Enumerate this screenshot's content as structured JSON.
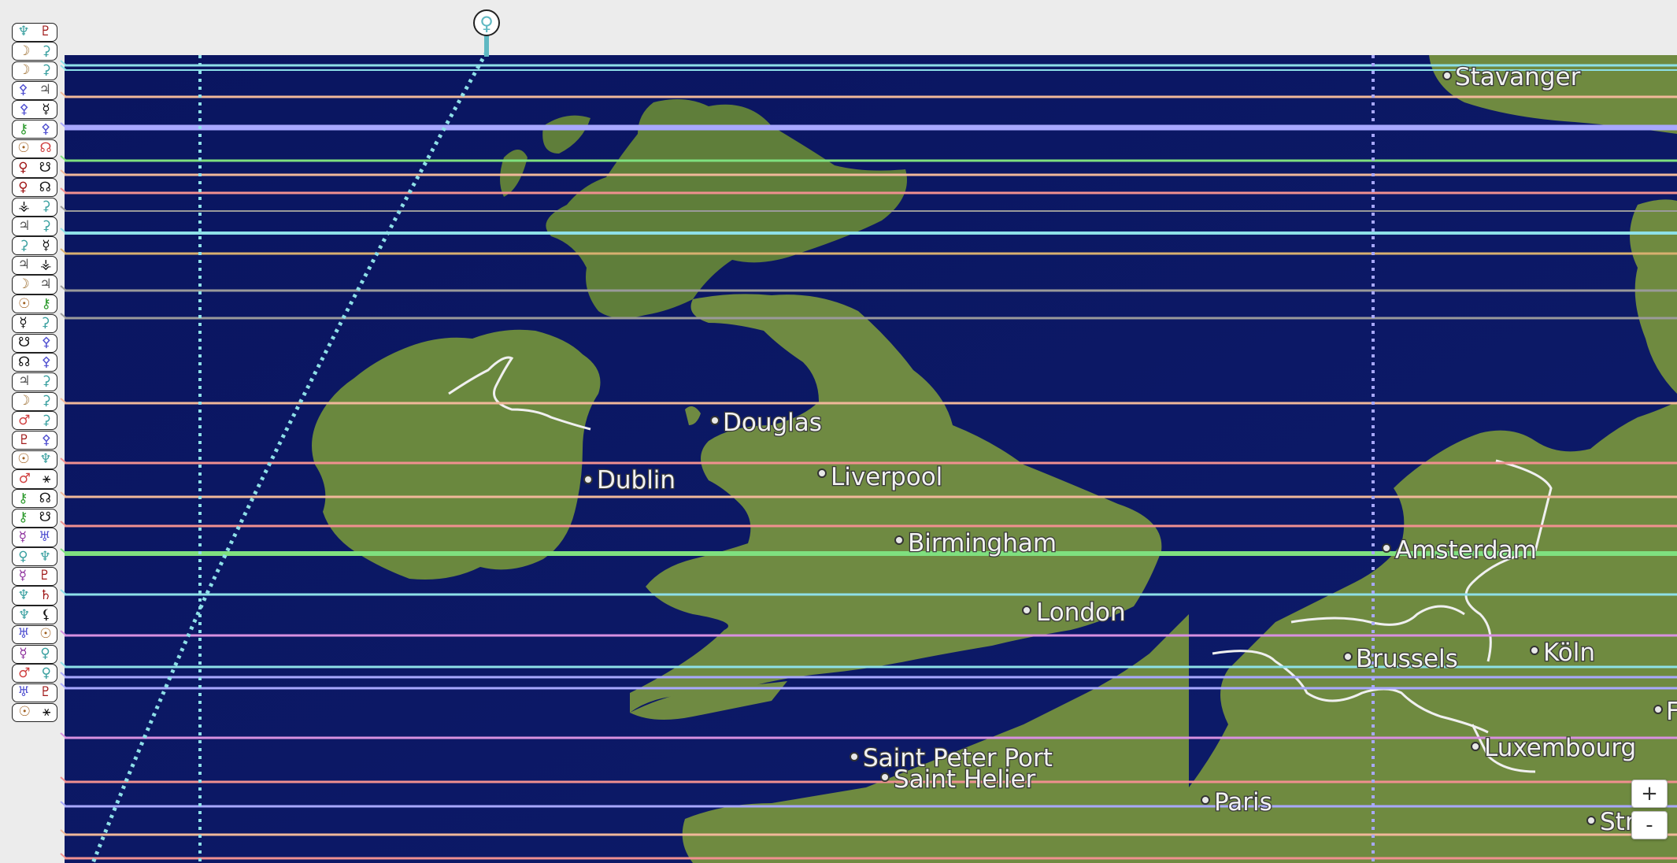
{
  "planet_marker": {
    "glyph": "♀",
    "color": "#5fb8c2"
  },
  "cities": [
    {
      "name": "Stavanger"
    },
    {
      "name": "Douglas"
    },
    {
      "name": "Dublin"
    },
    {
      "name": "Liverpool"
    },
    {
      "name": "Birmingham"
    },
    {
      "name": "Amsterdam"
    },
    {
      "name": "London"
    },
    {
      "name": "Brussels"
    },
    {
      "name": "Köln"
    },
    {
      "name": "Luxembourg"
    },
    {
      "name": "Saint Peter Port"
    },
    {
      "name": "Saint Helier"
    },
    {
      "name": "Paris"
    },
    {
      "name": "Str"
    },
    {
      "name": "F"
    }
  ],
  "zoom": {
    "in_label": "+",
    "out_label": "-"
  },
  "aspect_pairs": [
    {
      "a": "♆",
      "ac": "#3aa0a0",
      "b": "♇",
      "bc": "#a01818"
    },
    {
      "a": "☽",
      "ac": "#9a6a2a",
      "b": "⚳",
      "bc": "#3aa0a0"
    },
    {
      "a": "☽",
      "ac": "#9a6a2a",
      "b": "⚳",
      "bc": "#3aa0a0"
    },
    {
      "a": "⚴",
      "ac": "#5050d0",
      "b": "♃",
      "bc": "#555"
    },
    {
      "a": "⚴",
      "ac": "#5050d0",
      "b": "☿",
      "bc": "#111"
    },
    {
      "a": "⚷",
      "ac": "#2c9a2c",
      "b": "⚴",
      "bc": "#5050d0"
    },
    {
      "a": "☉",
      "ac": "#a06020",
      "b": "☊",
      "bc": "#d04040"
    },
    {
      "a": "♀",
      "ac": "#a01818",
      "b": "☋",
      "bc": "#111"
    },
    {
      "a": "♀",
      "ac": "#a01818",
      "b": "☊",
      "bc": "#111"
    },
    {
      "a": "⚶",
      "ac": "#111",
      "b": "⚳",
      "bc": "#3aa0a0"
    },
    {
      "a": "♃",
      "ac": "#555",
      "b": "⚳",
      "bc": "#3aa0a0"
    },
    {
      "a": "⚳",
      "ac": "#3aa0a0",
      "b": "☿",
      "bc": "#111"
    },
    {
      "a": "♃",
      "ac": "#555",
      "b": "⚶",
      "bc": "#111"
    },
    {
      "a": "☽",
      "ac": "#9a6a2a",
      "b": "♃",
      "bc": "#555"
    },
    {
      "a": "☉",
      "ac": "#a06020",
      "b": "⚷",
      "bc": "#2c9a2c"
    },
    {
      "a": "☿",
      "ac": "#111",
      "b": "⚳",
      "bc": "#3aa0a0"
    },
    {
      "a": "☋",
      "ac": "#111",
      "b": "⚴",
      "bc": "#5050d0"
    },
    {
      "a": "☊",
      "ac": "#111",
      "b": "⚴",
      "bc": "#5050d0"
    },
    {
      "a": "♃",
      "ac": "#555",
      "b": "⚳",
      "bc": "#3aa0a0"
    },
    {
      "a": "☽",
      "ac": "#9a6a2a",
      "b": "⚳",
      "bc": "#3aa0a0"
    },
    {
      "a": "♂",
      "ac": "#d04040",
      "b": "⚳",
      "bc": "#3aa0a0"
    },
    {
      "a": "♇",
      "ac": "#a01818",
      "b": "⚴",
      "bc": "#5050d0"
    },
    {
      "a": "☉",
      "ac": "#a06020",
      "b": "♆",
      "bc": "#3aa0a0"
    },
    {
      "a": "♂",
      "ac": "#d04040",
      "b": "⚹",
      "bc": "#111"
    },
    {
      "a": "⚷",
      "ac": "#2c9a2c",
      "b": "☊",
      "bc": "#111"
    },
    {
      "a": "⚷",
      "ac": "#2c9a2c",
      "b": "☋",
      "bc": "#111"
    },
    {
      "a": "☿",
      "ac": "#8a2a9a",
      "b": "♅",
      "bc": "#5050d0"
    },
    {
      "a": "♀",
      "ac": "#3aa0a0",
      "b": "♆",
      "bc": "#3aa0a0"
    },
    {
      "a": "☿",
      "ac": "#8a2a9a",
      "b": "♇",
      "bc": "#a01818"
    },
    {
      "a": "♆",
      "ac": "#3aa0a0",
      "b": "♄",
      "bc": "#a01818"
    },
    {
      "a": "♆",
      "ac": "#3aa0a0",
      "b": "⚸",
      "bc": "#111"
    },
    {
      "a": "♅",
      "ac": "#5050d0",
      "b": "☉",
      "bc": "#a06020"
    },
    {
      "a": "☿",
      "ac": "#8a2a9a",
      "b": "♀",
      "bc": "#3aa0a0"
    },
    {
      "a": "♂",
      "ac": "#d04040",
      "b": "♀",
      "bc": "#3aa0a0"
    },
    {
      "a": "♅",
      "ac": "#5050d0",
      "b": "♇",
      "bc": "#a01818"
    },
    {
      "a": "☉",
      "ac": "#a06020",
      "b": "⚹",
      "bc": "#111"
    }
  ],
  "line_colors": {
    "cyan": "#8ee0e8",
    "peach": "#f0b89a",
    "lavender": "#a8a8ff",
    "green": "#7fe07f",
    "salmon": "#f09090",
    "grey": "#9a9a9a",
    "tan": "#d8b070",
    "purple": "#d890e0"
  }
}
